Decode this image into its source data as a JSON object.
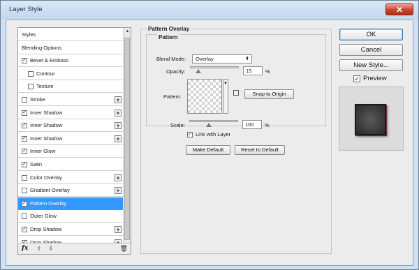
{
  "window": {
    "title": "Layer Style",
    "close_glyph": "✕"
  },
  "styles_list": {
    "items": [
      {
        "label": "Styles",
        "checkbox": false,
        "checked": false,
        "plus": false,
        "indent": false,
        "selected": false
      },
      {
        "label": "Blending Options",
        "checkbox": false,
        "checked": false,
        "plus": false,
        "indent": false,
        "selected": false
      },
      {
        "label": "Bevel & Emboss",
        "checkbox": true,
        "checked": true,
        "plus": false,
        "indent": false,
        "selected": false
      },
      {
        "label": "Contour",
        "checkbox": true,
        "checked": false,
        "plus": false,
        "indent": true,
        "selected": false
      },
      {
        "label": "Texture",
        "checkbox": true,
        "checked": false,
        "plus": false,
        "indent": true,
        "selected": false
      },
      {
        "label": "Stroke",
        "checkbox": true,
        "checked": false,
        "plus": true,
        "indent": false,
        "selected": false
      },
      {
        "label": "Inner Shadow",
        "checkbox": true,
        "checked": true,
        "plus": true,
        "indent": false,
        "selected": false
      },
      {
        "label": "Inner Shadow",
        "checkbox": true,
        "checked": true,
        "plus": true,
        "indent": false,
        "selected": false
      },
      {
        "label": "Inner Shadow",
        "checkbox": true,
        "checked": true,
        "plus": true,
        "indent": false,
        "selected": false
      },
      {
        "label": "Inner Glow",
        "checkbox": true,
        "checked": true,
        "plus": false,
        "indent": false,
        "selected": false
      },
      {
        "label": "Satin",
        "checkbox": true,
        "checked": true,
        "plus": false,
        "indent": false,
        "selected": false
      },
      {
        "label": "Color Overlay",
        "checkbox": true,
        "checked": false,
        "plus": true,
        "indent": false,
        "selected": false
      },
      {
        "label": "Gradient Overlay",
        "checkbox": true,
        "checked": false,
        "plus": true,
        "indent": false,
        "selected": false
      },
      {
        "label": "Pattern Overlay",
        "checkbox": true,
        "checked": true,
        "plus": false,
        "indent": false,
        "selected": true
      },
      {
        "label": "Outer Glow",
        "checkbox": true,
        "checked": false,
        "plus": false,
        "indent": false,
        "selected": false
      },
      {
        "label": "Drop Shadow",
        "checkbox": true,
        "checked": true,
        "plus": true,
        "indent": false,
        "selected": false
      },
      {
        "label": "Drop Shadow",
        "checkbox": true,
        "checked": true,
        "plus": true,
        "indent": false,
        "selected": false
      }
    ],
    "footer": {
      "fx_label": "fx",
      "up_glyph": "⬆",
      "down_glyph": "⬇",
      "trash_glyph": "🗑"
    }
  },
  "panel": {
    "section_title": "Pattern Overlay",
    "group_title": "Pattern",
    "blend_mode_label": "Blend Mode:",
    "blend_mode_value": "Overlay",
    "opacity_label": "Opacity:",
    "opacity_value": "15",
    "opacity_fraction": 0.15,
    "pattern_label": "Pattern:",
    "snap_button": "Snap to Origin",
    "scale_label": "Scale:",
    "scale_value": "100",
    "scale_fraction": 0.38,
    "percent": "%",
    "link_with_layer_label": "Link with Layer",
    "link_with_layer_checked": true,
    "make_default_button": "Make Default",
    "reset_default_button": "Reset to Default"
  },
  "actions": {
    "ok": "OK",
    "cancel": "Cancel",
    "new_style": "New Style...",
    "preview_label": "Preview",
    "preview_checked": true
  },
  "colors": {
    "selection": "#3399ff",
    "close_button": "#c8432b"
  }
}
